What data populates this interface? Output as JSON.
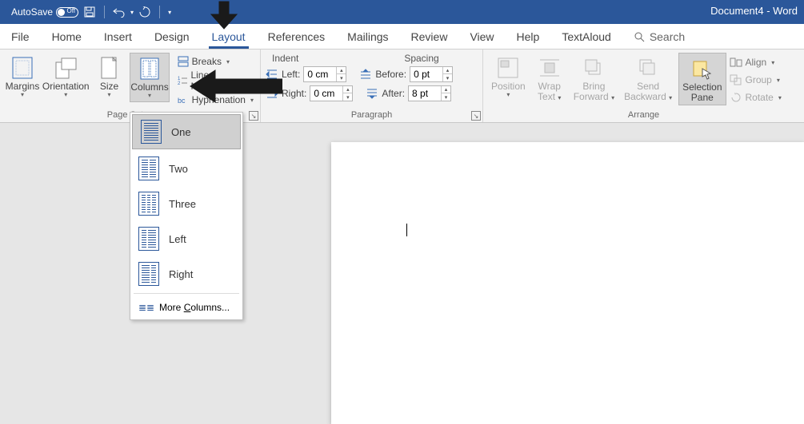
{
  "titlebar": {
    "autosave_label": "AutoSave",
    "autosave_state": "Off",
    "doc_title": "Document4  -  Word"
  },
  "tabs": {
    "file": "File",
    "home": "Home",
    "insert": "Insert",
    "design": "Design",
    "layout": "Layout",
    "references": "References",
    "mailings": "Mailings",
    "review": "Review",
    "view": "View",
    "help": "Help",
    "textaloud": "TextAloud",
    "search": "Search"
  },
  "ribbon": {
    "page_setup": {
      "group_label": "Page Setup",
      "margins": "Margins",
      "orientation": "Orientation",
      "size": "Size",
      "columns": "Columns",
      "breaks": "Breaks",
      "line_numbers": "Line Numbers",
      "hyphenation": "Hyphenation"
    },
    "paragraph": {
      "group_label": "Paragraph",
      "indent_label": "Indent",
      "spacing_label": "Spacing",
      "left_label": "Left:",
      "right_label": "Right:",
      "before_label": "Before:",
      "after_label": "After:",
      "left_value": "0 cm",
      "right_value": "0 cm",
      "before_value": "0 pt",
      "after_value": "8 pt"
    },
    "arrange": {
      "group_label": "Arrange",
      "position": "Position",
      "wrap_text_line1": "Wrap",
      "wrap_text_line2": "Text",
      "bring_forward_line1": "Bring",
      "bring_forward_line2": "Forward",
      "send_backward_line1": "Send",
      "send_backward_line2": "Backward",
      "selection_pane_line1": "Selection",
      "selection_pane_line2": "Pane",
      "align": "Align",
      "group": "Group",
      "rotate": "Rotate"
    }
  },
  "columns_menu": {
    "one": "One",
    "two": "Two",
    "three": "Three",
    "left": "Left",
    "right": "Right",
    "more_pre": "More ",
    "more_u": "C",
    "more_post": "olumns..."
  }
}
